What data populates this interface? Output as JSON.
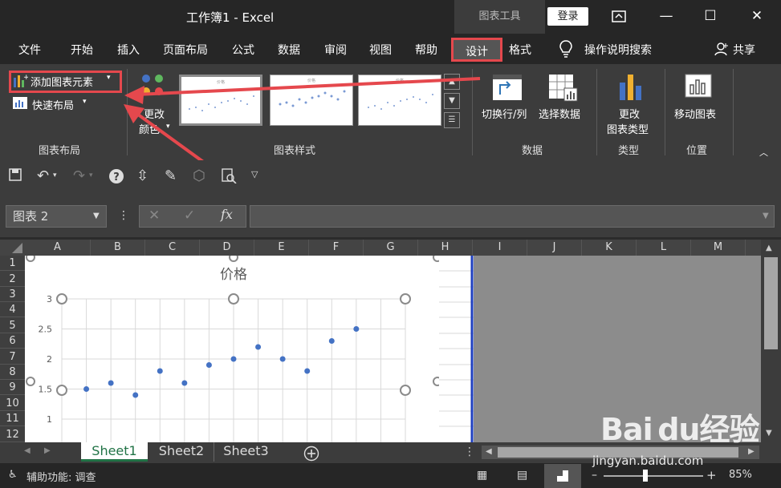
{
  "titlebar": {
    "title": "工作簿1  -  Excel",
    "chart_tools": "图表工具",
    "login": "登录"
  },
  "menu": {
    "items": [
      "文件",
      "开始",
      "插入",
      "页面布局",
      "公式",
      "数据",
      "审阅",
      "视图",
      "帮助",
      "设计",
      "格式"
    ],
    "tell_me": "操作说明搜索",
    "share": "共享"
  },
  "ribbon": {
    "add_element": "添加图表元素",
    "quick_layout": "快速布局",
    "change_colors_1": "更改",
    "change_colors_2": "颜色",
    "switch_row_col": "切换行/列",
    "select_data": "选择数据",
    "change_type_1": "更改",
    "change_type_2": "图表类型",
    "move_chart": "移动图表",
    "groups": {
      "layout": "图表布局",
      "styles": "图表样式",
      "data": "数据",
      "type": "类型",
      "location": "位置"
    }
  },
  "namebox": "图表 2",
  "fx": "fx",
  "columns": [
    "A",
    "B",
    "C",
    "D",
    "E",
    "F",
    "G",
    "H",
    "I",
    "J",
    "K",
    "L",
    "M"
  ],
  "rows": [
    "1",
    "2",
    "3",
    "4",
    "5",
    "6",
    "7",
    "8",
    "9",
    "10",
    "11",
    "12"
  ],
  "sheets": [
    "Sheet1",
    "Sheet2",
    "Sheet3"
  ],
  "status": {
    "accessibility": "辅助功能: 调查",
    "zoom": "85%"
  },
  "watermark": {
    "logo": "Bai du经验",
    "url": "jingyan.baidu.com"
  },
  "chart_data": {
    "type": "scatter",
    "title": "价格",
    "x": [
      1,
      2,
      3,
      4,
      5,
      6,
      7,
      8,
      9,
      10,
      11,
      12
    ],
    "y": [
      1.5,
      1.6,
      1.4,
      1.8,
      1.6,
      1.9,
      2.0,
      2.2,
      2.0,
      1.8,
      2.3,
      2.5
    ],
    "yticks": [
      "3",
      "2.5",
      "2",
      "1.5",
      "1"
    ],
    "ylim": [
      0,
      3
    ],
    "xlim": [
      0,
      14
    ],
    "grid": true,
    "color": "#4472c4"
  }
}
